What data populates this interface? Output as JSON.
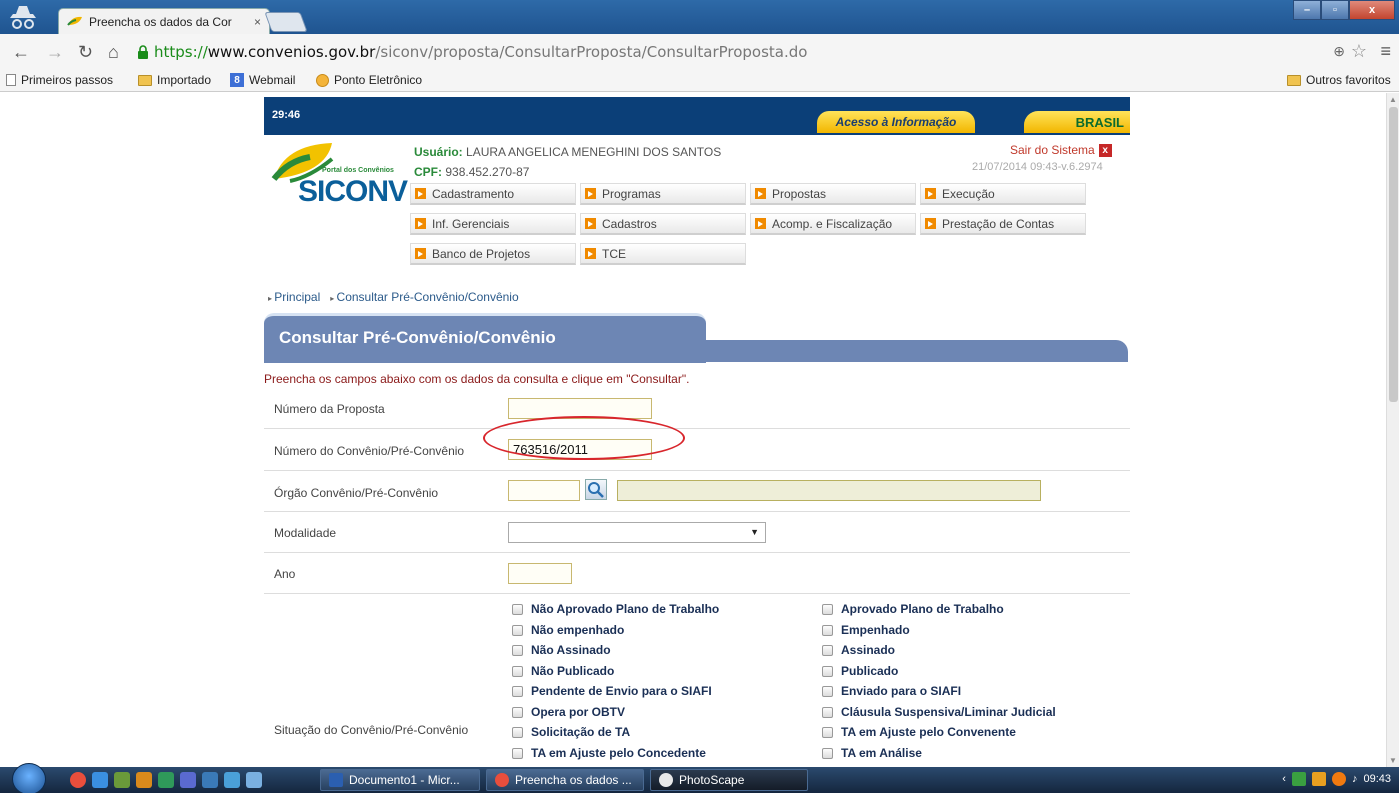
{
  "browser": {
    "tab_title": "Preencha os dados da Cor",
    "tab_close": "×",
    "url_scheme": "https://",
    "url_host": "www.convenios.gov.br",
    "url_path": "/siconv/proposta/ConsultarProposta/ConsultarProposta.do",
    "bookmarks": [
      "Primeiros passos",
      "Importado",
      "Webmail",
      "Ponto Eletrônico"
    ],
    "other_bookmarks": "Outros favoritos"
  },
  "header": {
    "timer": "29:46",
    "acesso": "Acesso à Informação",
    "brasil": "BRASIL",
    "logo_portal": "Portal dos Convênios",
    "logo_name": "SICONV",
    "user_label": "Usuário:",
    "user_name": "LAURA ANGELICA MENEGHINI DOS SANTOS",
    "cpf_label": "CPF:",
    "cpf_value": "938.452.270-87",
    "logout": "Sair do Sistema",
    "version": "21/07/2014 09:43-v.6.2974"
  },
  "menu": {
    "items": [
      "Cadastramento",
      "Programas",
      "Propostas",
      "Execução",
      "Inf. Gerenciais",
      "Cadastros",
      "Acomp. e Fiscalização",
      "Prestação de Contas",
      "Banco de Projetos",
      "TCE"
    ]
  },
  "breadcrumb": [
    "Principal",
    "Consultar Pré-Convênio/Convênio"
  ],
  "form": {
    "title": "Consultar Pré-Convênio/Convênio",
    "instructions": "Preencha os campos abaixo com os dados da consulta e clique em \"Consultar\".",
    "numero_proposta_label": "Número da Proposta",
    "numero_proposta_value": "",
    "numero_convenio_label": "Número do Convênio/Pré-Convênio",
    "numero_convenio_value": "763516/2011",
    "orgao_label": "Órgão Convênio/Pré-Convênio",
    "modalidade_label": "Modalidade",
    "modalidade_value": "",
    "ano_label": "Ano",
    "situacao_label": "Situação do Convênio/Pré-Convênio",
    "situacao_left": [
      "Não Aprovado Plano de Trabalho",
      "Não empenhado",
      "Não Assinado",
      "Não Publicado",
      "Pendente de Envio para o SIAFI",
      "Opera por OBTV",
      "Solicitação de TA",
      "TA em Ajuste pelo Concedente"
    ],
    "situacao_right": [
      "Aprovado Plano de Trabalho",
      "Empenhado",
      "Assinado",
      "Publicado",
      "Enviado para o SIAFI",
      "Cláusula Suspensiva/Liminar Judicial",
      "TA em Ajuste pelo Convenente",
      "TA em Análise"
    ]
  },
  "taskbar": {
    "tasks": [
      "Documento1 - Micr...",
      "Preencha os dados ...",
      "PhotoScape"
    ],
    "clock": "09:43"
  }
}
